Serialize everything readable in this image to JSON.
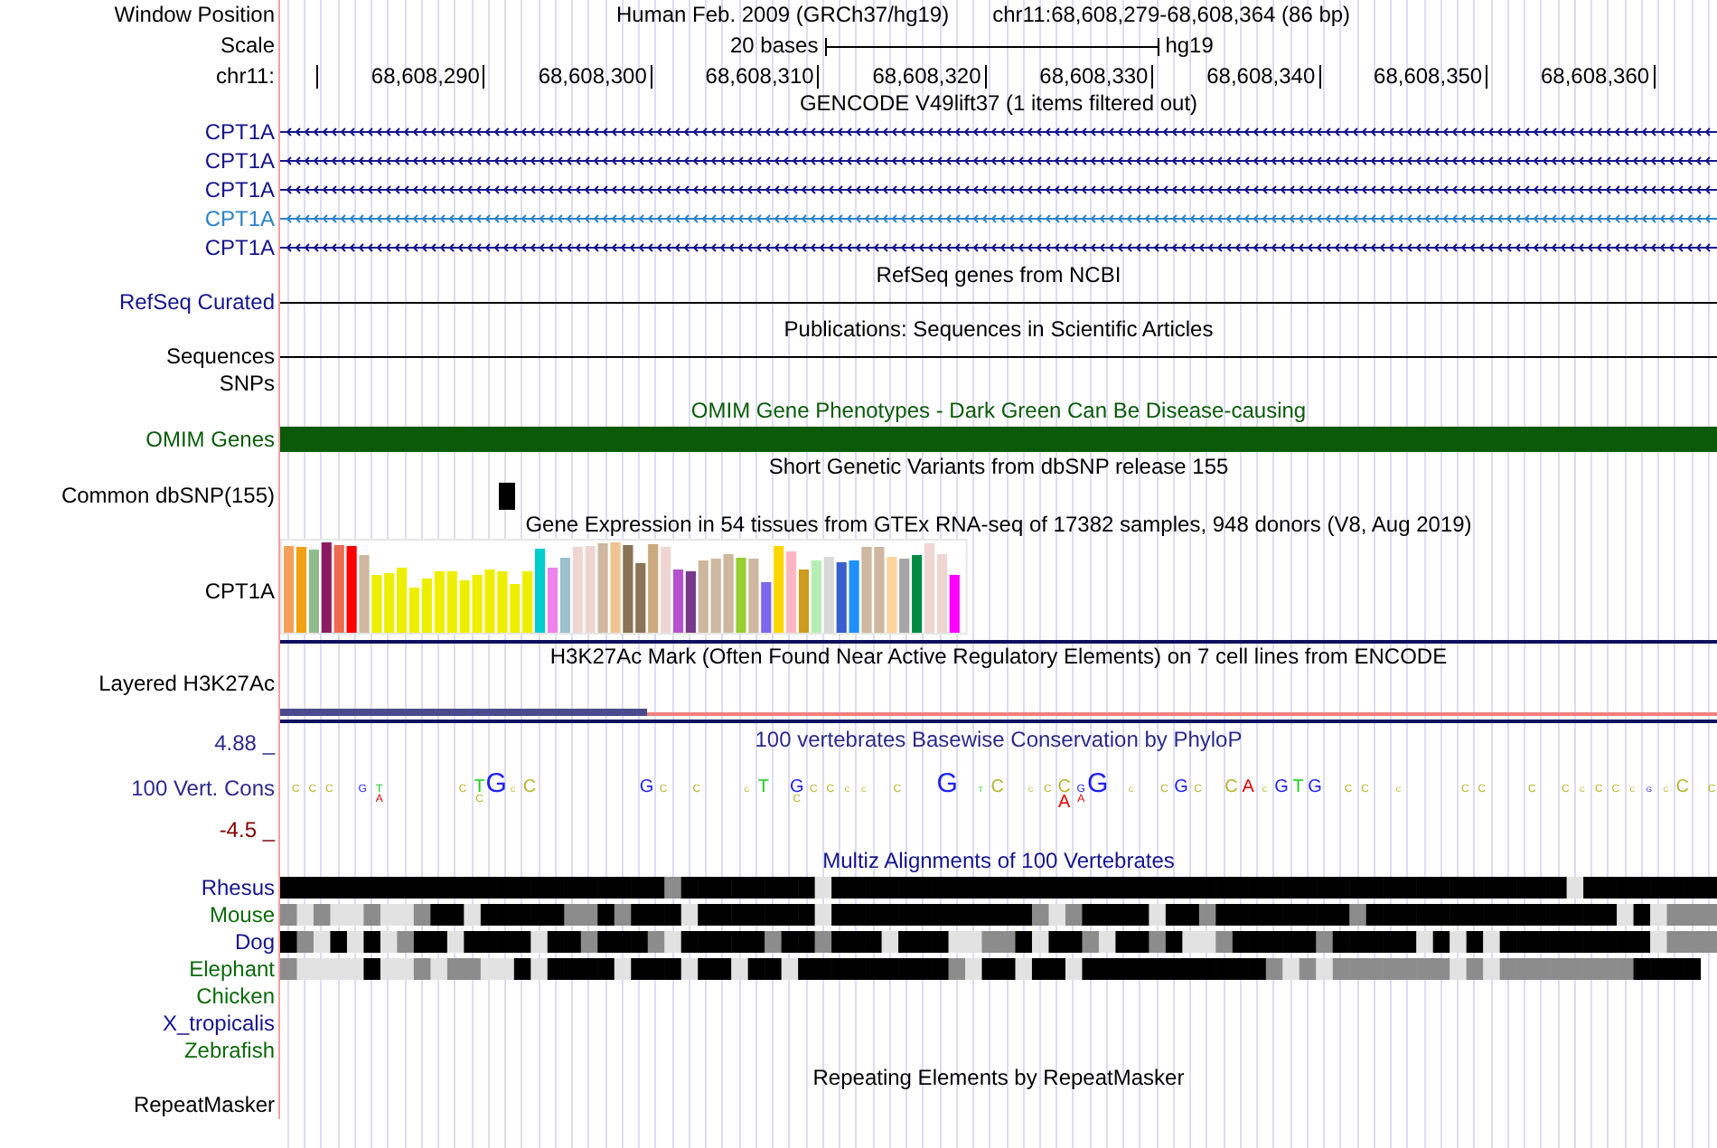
{
  "position": {
    "label": "Window Position",
    "assembly": "Human Feb. 2009 (GRCh37/hg19)",
    "region": "chr11:68,608,279-68,608,364 (86 bp)"
  },
  "scale": {
    "label": "Scale",
    "span": "20 bases",
    "assembly": "hg19"
  },
  "ruler": {
    "label": "chr11:",
    "ticks": [
      "68,608,290",
      "68,608,300",
      "68,608,310",
      "68,608,320",
      "68,608,330",
      "68,608,340",
      "68,608,350",
      "68,608,360"
    ]
  },
  "tracks": [
    {
      "kind": "genes",
      "title": "GENCODE V49lift37 (1 items filtered out)",
      "rows": [
        {
          "name": "CPT1A",
          "color": "#14148c"
        },
        {
          "name": "CPT1A",
          "color": "#14148c"
        },
        {
          "name": "CPT1A",
          "color": "#14148c"
        },
        {
          "name": "CPT1A",
          "color": "#2c82c8"
        },
        {
          "name": "CPT1A",
          "color": "#14148c"
        }
      ]
    },
    {
      "kind": "line",
      "title": "RefSeq genes from NCBI",
      "label": "RefSeq Curated",
      "color": "#14148c"
    },
    {
      "kind": "line",
      "title": "Publications: Sequences in Scientific Articles",
      "label": "Sequences",
      "color": "#000000"
    },
    {
      "kind": "empty",
      "label": "SNPs",
      "color": "#000000"
    },
    {
      "kind": "band",
      "title": "OMIM Gene Phenotypes - Dark Green Can Be Disease-causing",
      "label": "OMIM Genes",
      "color": "#0a5a0a"
    },
    {
      "kind": "variants",
      "title": "Short Genetic Variants from dbSNP release 155",
      "label": "Common dbSNP(155)",
      "color": "#000000"
    },
    {
      "kind": "expression",
      "title": "Gene Expression in 54 tissues from GTEx RNA-seq of 17382 samples, 948 donors (V8, Aug 2019)",
      "label": "CPT1A",
      "color": "#000000",
      "bars": [
        {
          "color": "#f5a05a"
        },
        {
          "color": "#f0a010"
        },
        {
          "color": "#8fbc8f"
        },
        {
          "color": "#8b1c62"
        },
        {
          "color": "#ee6a50"
        },
        {
          "color": "#ff0000"
        },
        {
          "color": "#cdb79e"
        },
        {
          "color": "#eeee00"
        },
        {
          "color": "#eeee00"
        },
        {
          "color": "#eeee00"
        },
        {
          "color": "#eeee00"
        },
        {
          "color": "#eeee00"
        },
        {
          "color": "#eeee00"
        },
        {
          "color": "#eeee00"
        },
        {
          "color": "#eeee00"
        },
        {
          "color": "#eeee00"
        },
        {
          "color": "#eeee00"
        },
        {
          "color": "#eeee00"
        },
        {
          "color": "#eeee00"
        },
        {
          "color": "#eeee00"
        },
        {
          "color": "#00cdcd"
        },
        {
          "color": "#ee82ee"
        },
        {
          "color": "#9ac0cd"
        },
        {
          "color": "#eed5d2"
        },
        {
          "color": "#eed5d2"
        },
        {
          "color": "#cdb79e"
        },
        {
          "color": "#eec591"
        },
        {
          "color": "#8b7355"
        },
        {
          "color": "#8b7355"
        },
        {
          "color": "#cdaa7d"
        },
        {
          "color": "#eed5d2"
        },
        {
          "color": "#b452cd"
        },
        {
          "color": "#7a378b"
        },
        {
          "color": "#cdb79e"
        },
        {
          "color": "#cdb79e"
        },
        {
          "color": "#cdb79e"
        },
        {
          "color": "#9acd32"
        },
        {
          "color": "#cdb79e"
        },
        {
          "color": "#7b68ee"
        },
        {
          "color": "#ffd700"
        },
        {
          "color": "#ffb6c1"
        },
        {
          "color": "#cd9b1d"
        },
        {
          "color": "#b4eeb4"
        },
        {
          "color": "#d9d9d9"
        },
        {
          "color": "#3a5fcd"
        },
        {
          "color": "#1e90ff"
        },
        {
          "color": "#cdb79e"
        },
        {
          "color": "#cdb79e"
        },
        {
          "color": "#ffd39b"
        },
        {
          "color": "#a6a6a6"
        },
        {
          "color": "#008b45"
        },
        {
          "color": "#eed5d2"
        },
        {
          "color": "#eed5d2"
        },
        {
          "color": "#ff00ff"
        }
      ]
    },
    {
      "kind": "signal",
      "title": "H3K27Ac Mark (Often Found Near Active Regulatory Elements) on 7 cell lines from ENCODE",
      "label": "Layered H3K27Ac",
      "color": "#000000"
    },
    {
      "kind": "conservation",
      "title": "100 vertebrates Basewise Conservation by PhyloP",
      "label": "100 Vert. Cons",
      "color": "#2a2a8c",
      "max": "4.88 _",
      "min": "-4.5 _",
      "letters": [
        {
          "base": "C"
        },
        {
          "base": "C"
        },
        {
          "base": "C"
        },
        {
          "base": "G"
        },
        {
          "base": "T",
          "below": "A"
        },
        {
          "base": "C"
        },
        {
          "base": "T",
          "below": "C"
        },
        {
          "base": "G"
        },
        {
          "base": "C"
        },
        {
          "base": "C"
        },
        {
          "base": "G"
        },
        {
          "base": "C"
        },
        {
          "base": "C"
        },
        {
          "base": "C"
        },
        {
          "base": "T"
        },
        {
          "base": "G",
          "below": "C"
        },
        {
          "base": "C"
        },
        {
          "base": "C"
        },
        {
          "base": "C"
        },
        {
          "base": "C"
        },
        {
          "base": "C"
        },
        {
          "base": "G"
        },
        {
          "base": "T"
        },
        {
          "base": "C"
        },
        {
          "base": "C"
        },
        {
          "base": "C"
        },
        {
          "base": "C",
          "below": "A"
        },
        {
          "base": "G",
          "below": "A"
        },
        {
          "base": "G"
        },
        {
          "base": "C"
        },
        {
          "base": "C"
        },
        {
          "base": "G"
        },
        {
          "base": "C"
        },
        {
          "base": "C"
        },
        {
          "base": "A"
        },
        {
          "base": "C"
        },
        {
          "base": "G"
        },
        {
          "base": "T"
        },
        {
          "base": "G"
        },
        {
          "base": "C"
        },
        {
          "base": "C"
        },
        {
          "base": "C"
        },
        {
          "base": "C"
        },
        {
          "base": "C"
        },
        {
          "base": "C"
        },
        {
          "base": "C"
        },
        {
          "base": "C"
        },
        {
          "base": "C"
        },
        {
          "base": "C"
        },
        {
          "base": "C"
        },
        {
          "base": "G"
        },
        {
          "base": "C"
        },
        {
          "base": "C"
        },
        {
          "base": "C"
        }
      ]
    },
    {
      "kind": "alignment",
      "title": "Multiz Alignments of 100 Vertebrates",
      "species": [
        {
          "name": "Rhesus",
          "color": "#14148c"
        },
        {
          "name": "Mouse",
          "color": "#0a6a0a"
        },
        {
          "name": "Dog",
          "color": "#14148c"
        },
        {
          "name": "Elephant",
          "color": "#0a6a0a"
        },
        {
          "name": "Chicken",
          "color": "#0a6a0a"
        },
        {
          "name": "X_tropicalis",
          "color": "#14148c"
        },
        {
          "name": "Zebrafish",
          "color": "#0a6a0a"
        }
      ]
    },
    {
      "kind": "title",
      "title": "Repeating Elements by RepeatMasker",
      "label": "RepeatMasker",
      "color": "#000000"
    }
  ]
}
